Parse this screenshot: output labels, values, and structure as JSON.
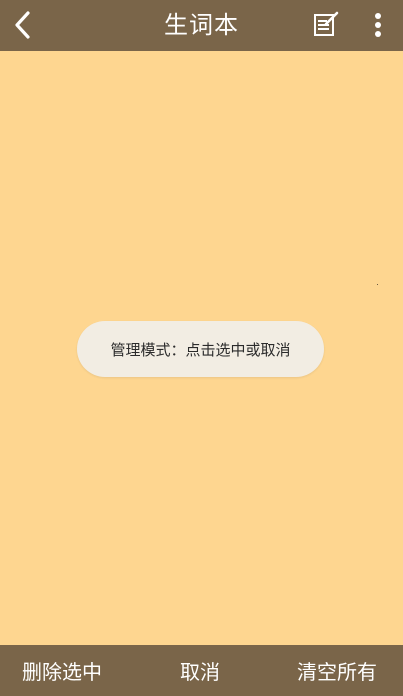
{
  "topbar": {
    "title": "生词本",
    "back_icon": "chevron-left-icon",
    "edit_icon": "edit-note-icon",
    "more_icon": "more-vert-icon"
  },
  "toast": {
    "message": "管理模式：点击选中或取消"
  },
  "bottombar": {
    "delete_selected_label": "删除选中",
    "cancel_label": "取消",
    "clear_all_label": "清空所有"
  },
  "colors": {
    "bar_background": "#7A6549",
    "content_background": "#FED690",
    "toast_background": "#F2EDE3",
    "bar_text": "#FFFFFF"
  }
}
